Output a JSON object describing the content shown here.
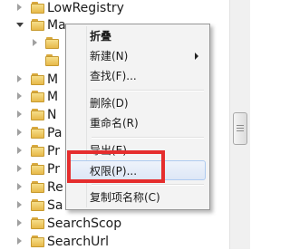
{
  "tree": {
    "rows": [
      {
        "label": "LowRegistry",
        "expander": "collapsed"
      },
      {
        "label": "Ma",
        "expander": "expanded"
      },
      {
        "label": "",
        "expander": "collapsed"
      },
      {
        "label": "",
        "expander": "none"
      },
      {
        "label": "M",
        "expander": "collapsed"
      },
      {
        "label": "M",
        "expander": "collapsed"
      },
      {
        "label": "N",
        "expander": "collapsed"
      },
      {
        "label": "Pa",
        "expander": "collapsed"
      },
      {
        "label": "Pr",
        "expander": "collapsed"
      },
      {
        "label": "Pr",
        "expander": "collapsed"
      },
      {
        "label": "Re",
        "expander": "collapsed"
      },
      {
        "label": "Sa",
        "expander": "collapsed"
      },
      {
        "label": "SearchScop",
        "expander": "collapsed"
      },
      {
        "label": "SearchUrl",
        "expander": "collapsed"
      }
    ]
  },
  "context_menu": {
    "items": [
      {
        "type": "item",
        "label": "折叠",
        "bold": true
      },
      {
        "type": "item",
        "label": "新建(N)",
        "submenu": true
      },
      {
        "type": "item",
        "label": "查找(F)..."
      },
      {
        "type": "separator"
      },
      {
        "type": "item",
        "label": "删除(D)"
      },
      {
        "type": "item",
        "label": "重命名(R)"
      },
      {
        "type": "separator"
      },
      {
        "type": "item",
        "label": "导出(E)"
      },
      {
        "type": "item",
        "label": "权限(P)...",
        "hover": true
      },
      {
        "type": "separator"
      },
      {
        "type": "item",
        "label": "复制项名称(C)"
      }
    ]
  },
  "colors": {
    "highlight_box": "#e52d2d",
    "menu_background": "#f3f3f3",
    "folder_yellow": "#e7b949"
  }
}
